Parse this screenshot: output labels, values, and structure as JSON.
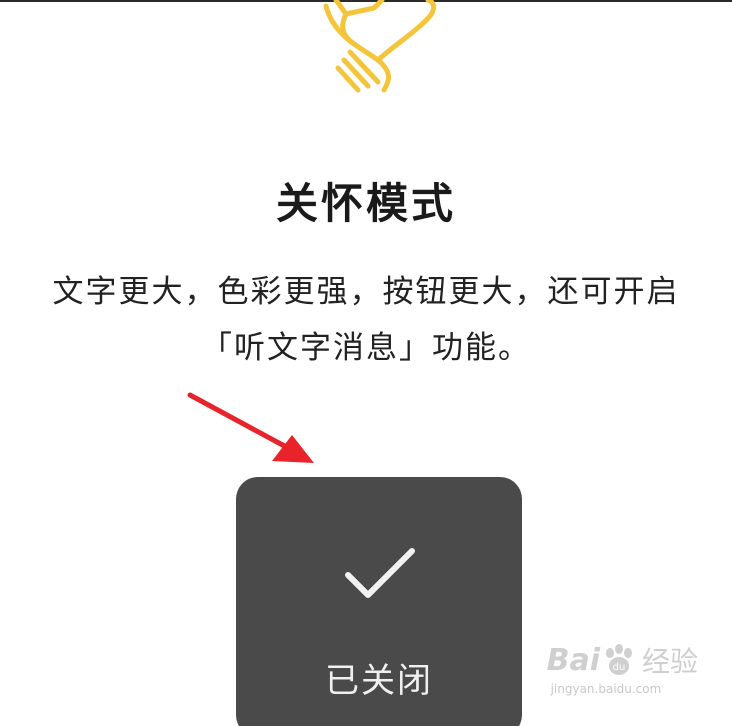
{
  "care_mode": {
    "title": "关怀模式",
    "description_line1": "文字更大，色彩更强，按钮更大，还可开启",
    "description_line2": "「听文字消息」功能。"
  },
  "toast": {
    "icon": "checkmark-icon",
    "label": "已关闭"
  },
  "watermark": {
    "brand_a": "Bai",
    "brand_b": "经验",
    "url": "jingyan.baidu.com"
  },
  "colors": {
    "accent_yellow": "#F4C53A",
    "arrow_red": "#E8232A",
    "toast_bg": "#4A4A4A",
    "text_dark": "#1A1A1A"
  }
}
